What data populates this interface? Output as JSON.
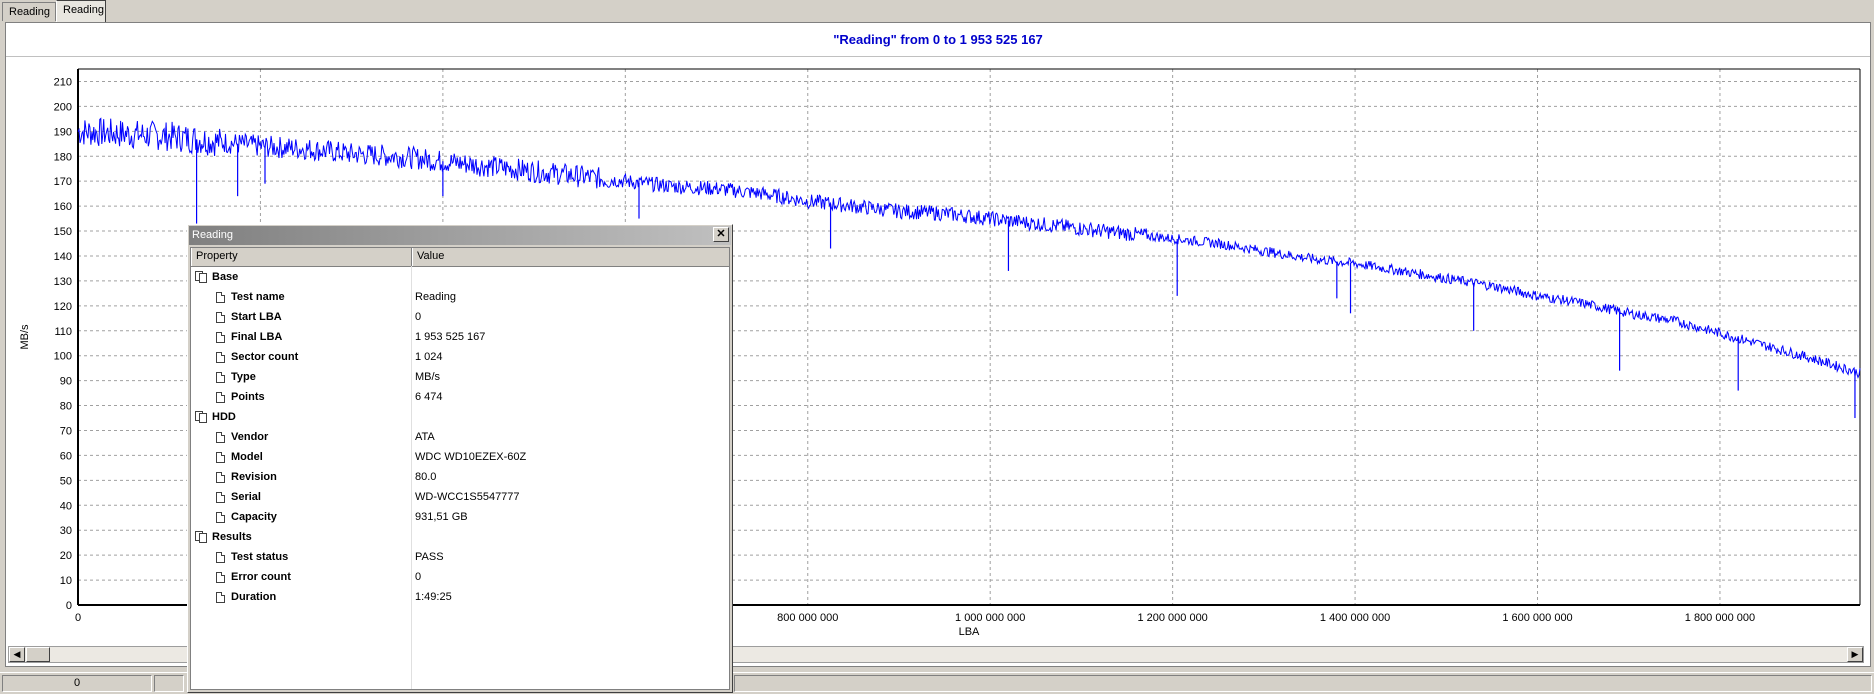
{
  "tabs": [
    {
      "label": "Reading"
    },
    {
      "label": "Reading"
    }
  ],
  "status": {
    "position": "0"
  },
  "chart_data": {
    "type": "line",
    "title": "\"Reading\" from 0 to 1 953 525 167",
    "xlabel": "LBA",
    "ylabel": "MB/s",
    "xlim": [
      0,
      1953525167
    ],
    "ylim": [
      0,
      215
    ],
    "x_ticks": [
      0,
      200000000,
      400000000,
      600000000,
      800000000,
      1000000000,
      1200000000,
      1400000000,
      1600000000,
      1800000000
    ],
    "x_tick_labels": [
      "0",
      "",
      "",
      "",
      "800 000 000",
      "1 000 000 000",
      "1 200 000 000",
      "1 400 000 000",
      "1 600 000 000",
      "1 800 000 000"
    ],
    "y_ticks": [
      0,
      10,
      20,
      30,
      40,
      50,
      60,
      70,
      80,
      90,
      100,
      110,
      120,
      130,
      140,
      150,
      160,
      170,
      180,
      190,
      200,
      210
    ],
    "grid": true,
    "color": "#0000ff",
    "series": [
      {
        "x": [
          0,
          50000000,
          100000000,
          150000000,
          200000000,
          250000000,
          300000000,
          350000000,
          400000000,
          450000000,
          500000000,
          550000000,
          600000000,
          650000000,
          700000000,
          750000000,
          800000000,
          850000000,
          900000000,
          950000000,
          1000000000,
          1050000000,
          1100000000,
          1150000000,
          1200000000,
          1250000000,
          1300000000,
          1350000000,
          1400000000,
          1450000000,
          1500000000,
          1550000000,
          1600000000,
          1650000000,
          1700000000,
          1750000000,
          1800000000,
          1850000000,
          1900000000,
          1953525167
        ],
        "y": [
          190,
          189,
          188,
          186,
          184,
          183,
          181,
          180,
          178,
          176,
          174,
          172,
          170,
          168,
          167,
          165,
          162,
          160,
          158,
          157,
          155,
          153,
          151,
          149,
          147,
          145,
          142,
          139,
          137,
          134,
          131,
          128,
          124,
          121,
          117,
          114,
          109,
          104,
          99,
          93
        ]
      }
    ],
    "dips": [
      {
        "x": 130000000,
        "y": 153
      },
      {
        "x": 175000000,
        "y": 164
      },
      {
        "x": 205000000,
        "y": 169
      },
      {
        "x": 400000000,
        "y": 164
      },
      {
        "x": 615000000,
        "y": 155
      },
      {
        "x": 825000000,
        "y": 143
      },
      {
        "x": 1020000000,
        "y": 134
      },
      {
        "x": 1205000000,
        "y": 124
      },
      {
        "x": 1380000000,
        "y": 123
      },
      {
        "x": 1395000000,
        "y": 117
      },
      {
        "x": 1530000000,
        "y": 110
      },
      {
        "x": 1690000000,
        "y": 94
      },
      {
        "x": 1820000000,
        "y": 86
      },
      {
        "x": 1948000000,
        "y": 75
      }
    ]
  },
  "dialog": {
    "title": "Reading",
    "col_property": "Property",
    "col_value": "Value",
    "groups": [
      {
        "name": "Base",
        "items": [
          {
            "k": "Test name",
            "v": "Reading"
          },
          {
            "k": "Start LBA",
            "v": "0"
          },
          {
            "k": "Final LBA",
            "v": "1 953 525 167"
          },
          {
            "k": "Sector count",
            "v": "1 024"
          },
          {
            "k": "Type",
            "v": "MB/s"
          },
          {
            "k": "Points",
            "v": "6 474"
          }
        ]
      },
      {
        "name": "HDD",
        "items": [
          {
            "k": "Vendor",
            "v": "ATA"
          },
          {
            "k": "Model",
            "v": "WDC WD10EZEX-60Z"
          },
          {
            "k": "Revision",
            "v": "80.0"
          },
          {
            "k": "Serial",
            "v": "WD-WCC1S5547777"
          },
          {
            "k": "Capacity",
            "v": "931,51 GB"
          }
        ]
      },
      {
        "name": "Results",
        "items": [
          {
            "k": "Test status",
            "v": "PASS"
          },
          {
            "k": "Error count",
            "v": "0"
          },
          {
            "k": "Duration",
            "v": "1:49:25"
          }
        ]
      }
    ]
  }
}
